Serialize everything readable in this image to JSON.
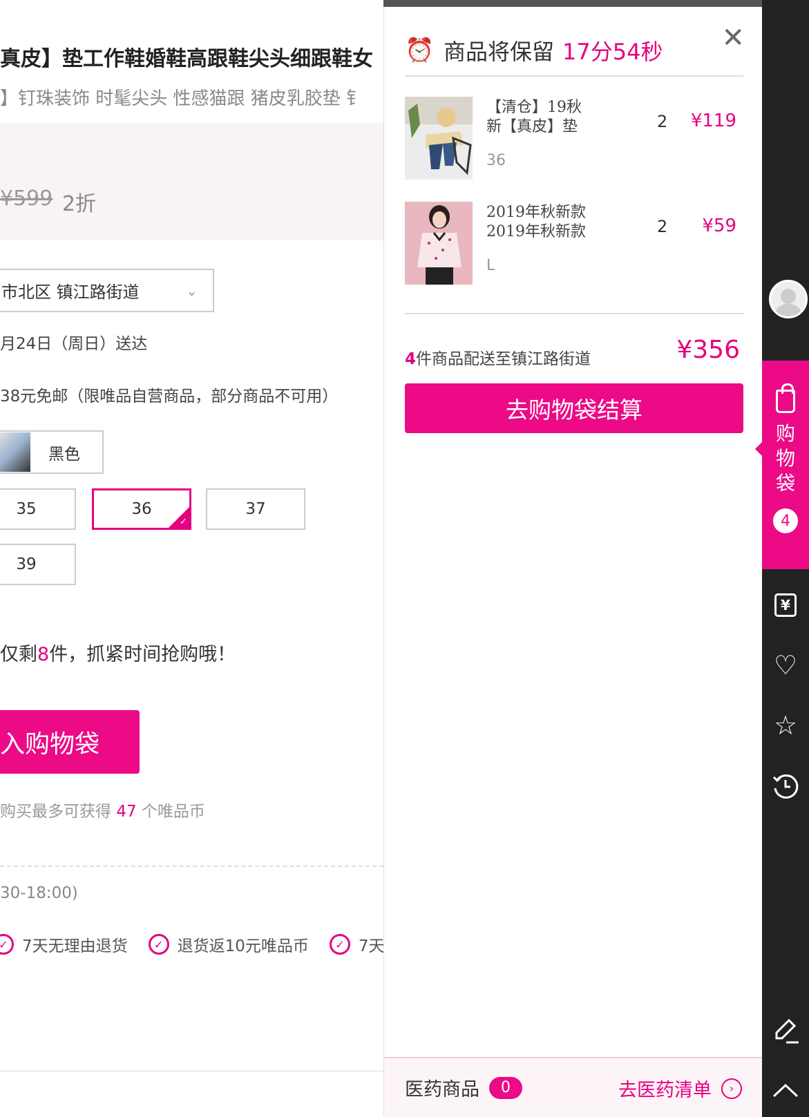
{
  "product": {
    "title": "真皮】垫工作鞋婚鞋高跟鞋尖头细跟鞋女",
    "subtitle": "】钉珠装饰 时髦尖头 性感猫跟 猪皮乳胶垫 钅",
    "old_price": "¥599",
    "discount": "2折",
    "address": "市北区 镇江路街道",
    "delivery": "月24日（周日）送达",
    "free_shipping": "38元免邮（限唯品自营商品，部分商品不可用）",
    "color_label": "黑色",
    "sizes": [
      "35",
      "36",
      "37",
      "39"
    ],
    "selected_size": "36",
    "stock_prefix": "仅剩",
    "stock_num": "8",
    "stock_suffix": "件，抓紧时间抢购哦！",
    "add_to_bag": "入购物袋",
    "coins_prefix": "购买最多可获得",
    "coins_num": "47",
    "coins_suffix": "个唯品币",
    "service_hours": "30-18:00)",
    "guarantees": [
      "7天无理由退货",
      "退货返10元唯品币",
      "7天"
    ]
  },
  "cart": {
    "header_text": "商品将保留",
    "timer": "17分54秒",
    "items": [
      {
        "name": "【清仓】19秋新【真皮】垫",
        "spec": "36",
        "qty": "2",
        "price": "¥119"
      },
      {
        "name": "2019年秋新款2019年秋新款",
        "spec": "L",
        "qty": "2",
        "price": "¥59"
      }
    ],
    "summary_count": "4",
    "summary_text": "件商品配送至镇江路街道",
    "total": "¥356",
    "checkout_label": "去购物袋结算",
    "pharma_label": "医药商品",
    "pharma_count": "0",
    "pharma_link": "去医药清单"
  },
  "sidebar": {
    "bag_label": "购物袋",
    "bag_count": "4",
    "icons": [
      "avatar-icon",
      "shopping-bag-icon",
      "coupon-icon",
      "heart-icon",
      "star-icon",
      "history-icon",
      "edit-icon",
      "back-to-top-icon"
    ]
  },
  "colors": {
    "accent": "#e4007f",
    "button": "#ec0a87",
    "sidebar_bg": "#222222"
  }
}
